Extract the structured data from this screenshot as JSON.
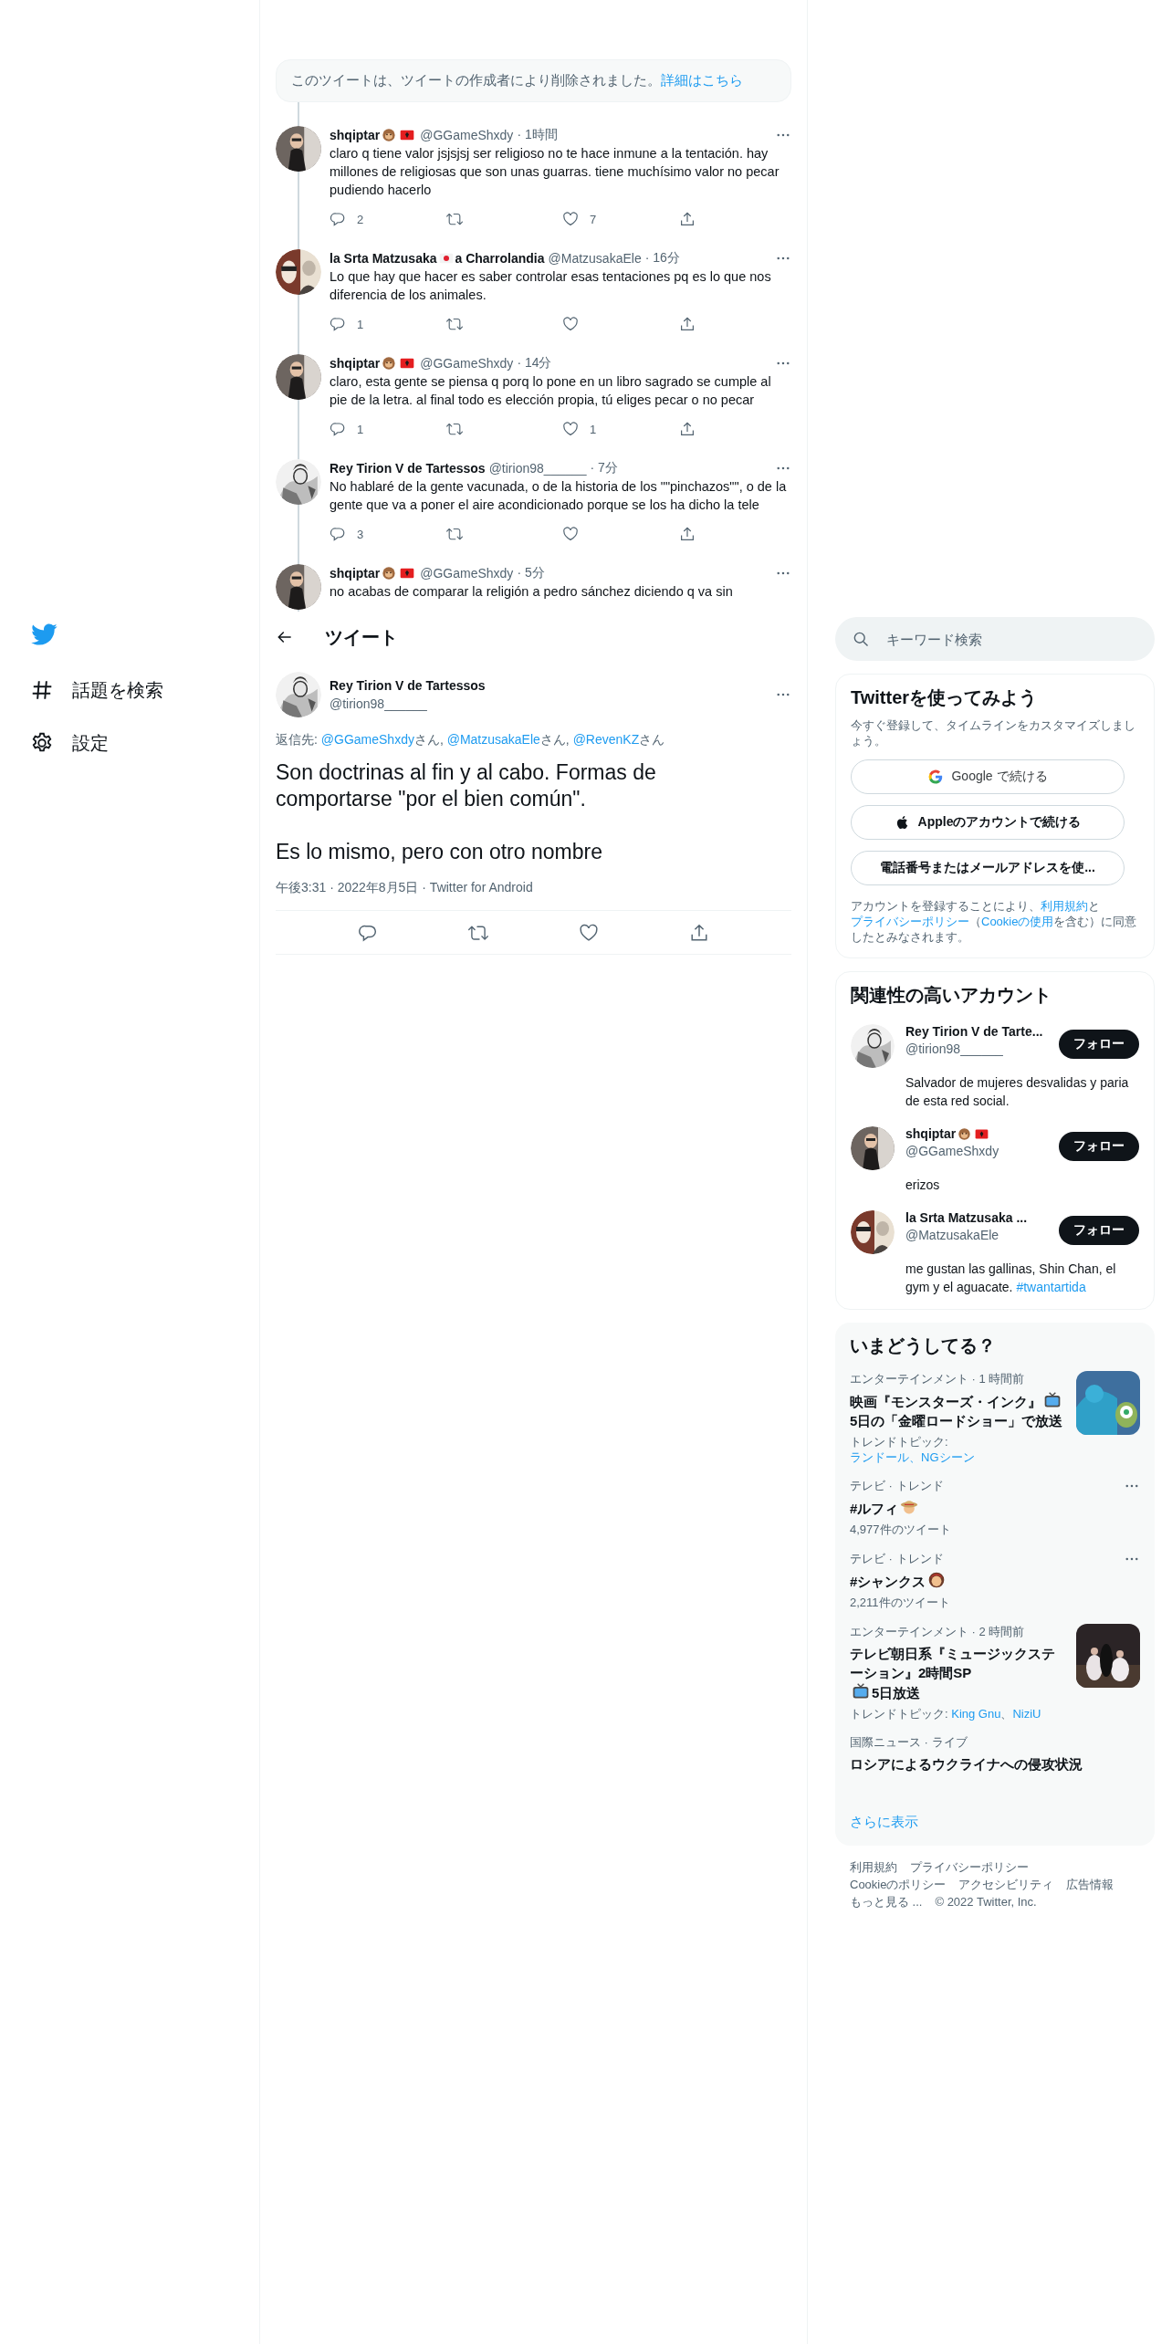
{
  "nav": {
    "items": [
      {
        "kind": "hash",
        "label": "話題を検索"
      },
      {
        "kind": "gear",
        "label": "設定"
      }
    ]
  },
  "thread": {
    "deleted_notice": {
      "text": "このツイートは、ツイートの作成者により削除されました。",
      "link": "詳細はこちら"
    },
    "tweets": [
      {
        "name": [
          {
            "text": "shqiptar"
          },
          {
            "kind": "monkey"
          },
          {
            "kind": "albania-flag"
          }
        ],
        "handle": "@GGameShxdy",
        "time": "· 1時間",
        "text": "claro q tiene valor jsjsjsj ser religioso no te hace inmune a la tentación. hay millones de religiosas que son unas guarras. tiene muchísimo valor no pecar pudiendo hacerlo",
        "replies": "2",
        "likes": "7"
      },
      {
        "name": [
          {
            "text": "la Srta Matzusaka"
          },
          {
            "kind": "japan-flag"
          },
          {
            "text": "a Charrolandia"
          }
        ],
        "handle": "@MatzusakaEle",
        "time": "· 16分",
        "text": "Lo que hay que hacer es saber controlar esas tentaciones pq es lo que nos diferencia de los animales.",
        "replies": "1"
      },
      {
        "name": [
          {
            "text": "shqiptar"
          },
          {
            "kind": "monkey"
          },
          {
            "kind": "albania-flag"
          }
        ],
        "handle": "@GGameShxdy",
        "time": "· 14分",
        "text": "claro, esta gente se piensa q porq lo pone en un libro sagrado se cumple al pie de la letra. al final todo es elección propia, tú eliges pecar o no pecar",
        "replies": "1",
        "likes": "1"
      },
      {
        "name": [
          {
            "text": "Rey Tirion V de Tartessos"
          }
        ],
        "handle": "@tirion98______",
        "time": "· 7分",
        "text": "No hablaré de la gente vacunada, o de la historia de los \"\"pinchazos\"\", o de la gente que va a poner el aire acondicionado porque se los ha dicho la tele",
        "replies": "3"
      },
      {
        "name": [
          {
            "text": "shqiptar"
          },
          {
            "kind": "monkey"
          },
          {
            "kind": "albania-flag"
          }
        ],
        "handle": "@GGameShxdy",
        "time": "· 5分",
        "text": "no acabas de comparar la religión a pedro sánchez diciendo q va sin",
        "cut": true
      }
    ]
  },
  "header": {
    "title": "ツイート"
  },
  "main_tweet": {
    "name": "Rey Tirion V de Tartessos",
    "handle": "@tirion98______",
    "reply_to": [
      {
        "text": "返信先: "
      },
      {
        "link": "@GGameShxdy"
      },
      {
        "text": "さん, "
      },
      {
        "link": "@MatzusakaEle"
      },
      {
        "text": "さん, "
      },
      {
        "link": "@RevenKZ"
      },
      {
        "text": "さん"
      }
    ],
    "paragraphs": [
      "Son doctrinas al fin y al cabo. Formas de comportarse \"por el bien común\".",
      "Es lo mismo, pero con otro nombre"
    ],
    "meta": "午後3:31 · 2022年8月5日 · Twitter for Android"
  },
  "search": {
    "placeholder": "キーワード検索"
  },
  "signup": {
    "title": "Twitterを使ってみよう",
    "subtitle": "今すぐ登録して、タイムラインをカスタマイズしましょう。",
    "buttons": [
      {
        "kind": "google",
        "label": "Google で続ける"
      },
      {
        "kind": "apple",
        "label": "Appleのアカウントで続ける"
      },
      {
        "kind": "phone",
        "label": "電話番号またはメールアドレスを使..."
      }
    ],
    "terms": [
      {
        "text": "アカウントを登録することにより、"
      },
      {
        "link": "利用規約"
      },
      {
        "text": "と"
      },
      {
        "link": "プライバシーポリシー"
      },
      {
        "text": "（"
      },
      {
        "link": "Cookieの使用"
      },
      {
        "text": "を含む）に同意したとみなされます。"
      }
    ]
  },
  "who_to_follow": {
    "title": "関連性の高いアカウント",
    "accounts": [
      {
        "name": [
          {
            "text": "Rey Tirion V de Tarte..."
          }
        ],
        "handle": "@tirion98______",
        "bio": [
          {
            "text": "Salvador de mujeres desvalidas y paria de esta red social."
          }
        ],
        "button": "フォロー"
      },
      {
        "name": [
          {
            "text": "shqiptar"
          },
          {
            "kind": "monkey"
          },
          {
            "kind": "albania-flag"
          }
        ],
        "handle": "@GGameShxdy",
        "bio": [
          {
            "text": "erizos"
          }
        ],
        "button": "フォロー"
      },
      {
        "name": [
          {
            "text": "la Srta Matzusaka ..."
          }
        ],
        "handle": "@MatzusakaEle",
        "bio": [
          {
            "text": "me gustan las gallinas, Shin Chan, el gym y el aguacate. "
          },
          {
            "link": "#twantartida"
          }
        ],
        "button": "フォロー"
      }
    ]
  },
  "trends": {
    "title": "いまどうしてる？",
    "items": [
      {
        "category": "エンターテインメント · 1 時間前",
        "title": [
          {
            "text": "映画『モンスターズ・インク』"
          },
          {
            "kind": "tv"
          },
          {
            "text": "5日の「金曜ロードショー」で放送"
          }
        ],
        "topics": [
          {
            "text": "トレンドトピック: "
          },
          {
            "link": "ランドール、NGシーン"
          }
        ],
        "thumbnail": {
          "kind": "picture"
        }
      },
      {
        "category": "テレビ · トレンド",
        "title": [
          {
            "text": "#ルフィ"
          },
          {
            "kind": "hat-face"
          }
        ],
        "count": "4,977件のツイート",
        "more": true
      },
      {
        "category": "テレビ · トレンド",
        "title": [
          {
            "text": "#シャンクス"
          },
          {
            "kind": "face"
          }
        ],
        "count": "2,211件のツイート",
        "more": true
      },
      {
        "category": "エンターテインメント · 2 時間前",
        "title": [
          {
            "text": "テレビ朝日系『ミュージックステーション』2時間SP"
          },
          {
            "kind": "tv"
          },
          {
            "text": "5日放送"
          }
        ],
        "topics": [
          {
            "text": "トレンドトピック: "
          },
          {
            "link": "King Gnu"
          },
          {
            "text": "、"
          },
          {
            "link": "NiziU"
          }
        ],
        "thumbnail": {
          "kind": "picture"
        }
      },
      {
        "category": "国際ニュース · ライブ",
        "title": [
          {
            "text": "ロシアによるウクライナへの侵攻状況"
          }
        ]
      }
    ],
    "show_more": "さらに表示"
  },
  "footer": {
    "rows": [
      [
        "利用規約",
        "プライバシーポリシー"
      ],
      [
        "Cookieのポリシー",
        "アクセシビリティ",
        "広告情報"
      ],
      [
        "もっと見る ...",
        "© 2022 Twitter, Inc."
      ]
    ]
  }
}
